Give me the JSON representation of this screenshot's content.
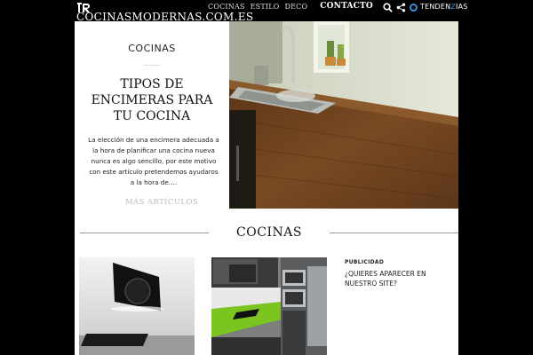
{
  "header": {
    "site_title": "COCINASMODERNAS.COM.ES",
    "nav": [
      {
        "label": "COCINAS"
      },
      {
        "label": "ESTILO"
      },
      {
        "label": "DECO"
      },
      {
        "label": "CONTACTO"
      }
    ],
    "trend_label_pre": "TENDEN",
    "trend_label_z": "Z",
    "trend_label_post": "IAS"
  },
  "feature": {
    "category": "COCINAS",
    "headline": "TIPOS DE ENCIMERAS PARA TU COCINA",
    "excerpt": "La elección de una encimera adecuada a la hora de planificar una cocina nueva nunca es algo sencillo, por este motivo con este artículo pretendemos ayudaros a la hora de….",
    "more_link": "MÁS ARTÍCULOS"
  },
  "section": {
    "title": "COCINAS"
  },
  "advertising": {
    "label": "PUBLICIDAD",
    "text": "¿QUIERES APARECER EN NUESTRO SITE?"
  },
  "colors": {
    "background": "#000000",
    "panel": "#ffffff",
    "accent": "#3a8fd6",
    "green_counter": "#7cc520"
  }
}
